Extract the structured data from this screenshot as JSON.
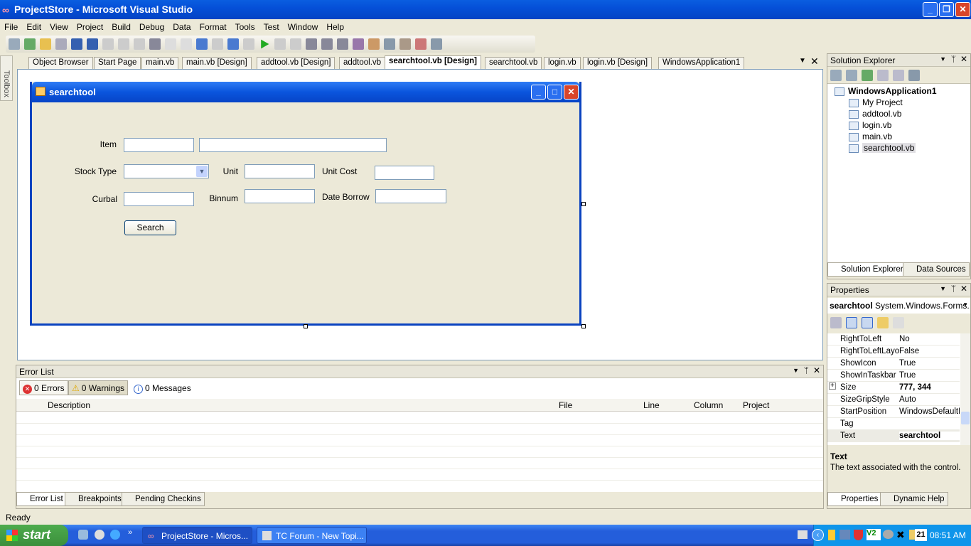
{
  "window": {
    "title": "ProjectStore - Microsoft Visual Studio"
  },
  "menu": [
    "File",
    "Edit",
    "View",
    "Project",
    "Build",
    "Debug",
    "Data",
    "Format",
    "Tools",
    "Test",
    "Window",
    "Help"
  ],
  "toolbox": {
    "label": "Toolbox"
  },
  "doc_tabs": [
    {
      "label": "Object Browser",
      "active": false
    },
    {
      "label": "Start Page",
      "active": false
    },
    {
      "label": "main.vb",
      "active": false
    },
    {
      "label": "main.vb [Design]",
      "active": false
    },
    {
      "label": "addtool.vb [Design]",
      "active": false
    },
    {
      "label": "addtool.vb",
      "active": false
    },
    {
      "label": "searchtool.vb [Design]",
      "active": true
    },
    {
      "label": "searchtool.vb",
      "active": false
    },
    {
      "label": "login.vb",
      "active": false
    },
    {
      "label": "login.vb [Design]",
      "active": false
    },
    {
      "label": "WindowsApplication1",
      "active": false
    }
  ],
  "form": {
    "title": "searchtool",
    "labels": {
      "item": "Item",
      "stock_type": "Stock Type",
      "unit": "Unit",
      "unit_cost": "Unit Cost",
      "curbal": "Curbal",
      "binnum": "Binnum",
      "date_borrow": "Date Borrow"
    },
    "search_button": "Search"
  },
  "error_list": {
    "title": "Error List",
    "errors": "0 Errors",
    "warnings": "0 Warnings",
    "messages": "0 Messages",
    "columns": [
      "Description",
      "File",
      "Line",
      "Column",
      "Project"
    ],
    "tabs": [
      "Error List",
      "Breakpoints",
      "Pending Checkins"
    ]
  },
  "solution_explorer": {
    "title": "Solution Explorer",
    "project": "WindowsApplication1",
    "items": [
      "My Project",
      "addtool.vb",
      "login.vb",
      "main.vb",
      "searchtool.vb"
    ],
    "selected": "searchtool.vb",
    "tabs": [
      "Solution Explorer",
      "Data Sources"
    ]
  },
  "properties": {
    "title": "Properties",
    "object_name": "searchtool",
    "object_type": "System.Windows.Forms.",
    "rows": [
      {
        "name": "RightToLeft",
        "value": "No"
      },
      {
        "name": "RightToLeftLayo",
        "value": "False"
      },
      {
        "name": "ShowIcon",
        "value": "True"
      },
      {
        "name": "ShowInTaskbar",
        "value": "True"
      },
      {
        "name": "Size",
        "value": "777, 344",
        "bold": true,
        "expandable": true
      },
      {
        "name": "SizeGripStyle",
        "value": "Auto"
      },
      {
        "name": "StartPosition",
        "value": "WindowsDefaultLo"
      },
      {
        "name": "Tag",
        "value": ""
      },
      {
        "name": "Text",
        "value": "searchtool",
        "bold": true
      }
    ],
    "desc_title": "Text",
    "desc_text": "The text associated with the control.",
    "tabs": [
      "Properties",
      "Dynamic Help"
    ]
  },
  "status": "Ready",
  "taskbar": {
    "start": "start",
    "tasks": [
      "ProjectStore - Micros...",
      "TC Forum - New Topi..."
    ],
    "date_badge": "21",
    "clock": "08:51 AM"
  },
  "colors": {
    "titlebar": "#0550d8",
    "form_border": "#0a43c0",
    "taskbar": "#245edb",
    "start": "#3c8f3c"
  }
}
